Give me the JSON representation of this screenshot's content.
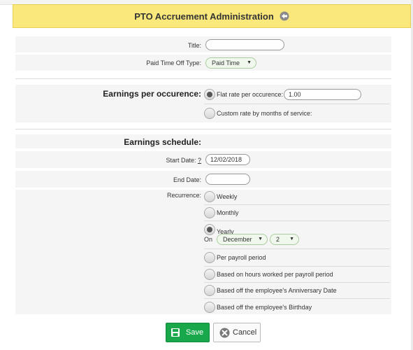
{
  "header": {
    "title": "PTO Accruement Administration"
  },
  "form": {
    "title_label": "Title:",
    "title_value": "",
    "pto_type_label": "Paid Time Off Type:",
    "pto_type_value": "Paid Time",
    "earnings_label": "Earnings per occurence:",
    "flat_rate_label": "Flat rate per occurence:",
    "flat_rate_value": "1.00",
    "custom_rate_label": "Custom rate by months of service:",
    "schedule_label": "Earnings schedule:",
    "start_date_label": "Start Date:",
    "start_date_help": "?",
    "start_date_value": "12/02/2018",
    "end_date_label": "End Date:",
    "end_date_value": "",
    "recurrence_label": "Recurrence:",
    "recurrence": {
      "weekly": "Weekly",
      "monthly": "Monthly",
      "yearly": "Yearly",
      "on_label": "On",
      "month_value": "December",
      "day_value": "2",
      "per_payroll": "Per payroll period",
      "hours_worked": "Based on hours worked per payroll period",
      "anniversary": "Based off the employee's Anniversary Date",
      "birthday": "Based off the employee's Birthday"
    }
  },
  "actions": {
    "save": "Save",
    "cancel": "Cancel"
  },
  "colors": {
    "header_bg": "#fbe87c",
    "save_bg": "#18a84b"
  }
}
